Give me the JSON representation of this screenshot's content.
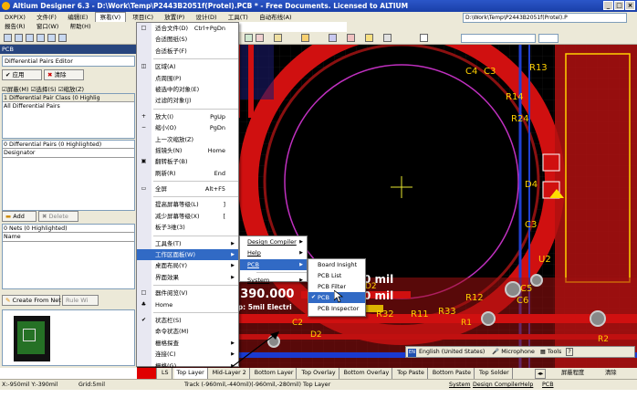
{
  "window": {
    "title": "Altium Designer 6.3 - D:\\Work\\Temp\\P2443B2051f(Protel).PCB * - Free Documents. Licensed to ALTIUM"
  },
  "menubar": {
    "row1": [
      "DXP(X)",
      "文件(F)",
      "编辑(E)",
      "察看(V)",
      "项目(C)",
      "放置(P)",
      "设计(D)",
      "工具(T)",
      "自动布线(A)"
    ],
    "row2": [
      "报告(R)",
      "窗口(W)",
      "帮助(H)"
    ],
    "path": "D:\\Work\\Temp\\P2443B2051f(Protel).P"
  },
  "panel": {
    "title": "PCB",
    "mode": "Differential Pairs Editor",
    "apply": "应用",
    "clear": "清除",
    "mask": "屏蔽(M)",
    "select": "选择(S)",
    "zoom": "缩放(Z)",
    "class_header": "1 Differential Pair Class (0 Highlig",
    "class_item": "All Differential Pairs",
    "pairs_header": "0 Differential Pairs (0 Highlighted)",
    "pairs_col": "Designator",
    "add": "Add",
    "delete": "Delete",
    "nets_header": "0 Nets (0 Highlighted)",
    "nets_col": "Name",
    "create": "Create From Net",
    "rule": "Rule Wi"
  },
  "view_menu": {
    "items": [
      {
        "icon": "□",
        "label": "适合文件(D)",
        "shortcut": "Ctrl+PgDn",
        "arrow": ""
      },
      {
        "icon": "",
        "label": "合适图纸(S)",
        "shortcut": "",
        "arrow": ""
      },
      {
        "icon": "",
        "label": "合适板子(F)",
        "shortcut": "",
        "arrow": ""
      },
      {
        "icon": "◫",
        "label": "区域(A)",
        "shortcut": "",
        "arrow": ""
      },
      {
        "icon": "",
        "label": "点周围(P)",
        "shortcut": "",
        "arrow": ""
      },
      {
        "icon": "",
        "label": "被选中的对象(E)",
        "shortcut": "",
        "arrow": ""
      },
      {
        "icon": "",
        "label": "过滤的对象(J)",
        "shortcut": "",
        "arrow": ""
      },
      {
        "icon": "+",
        "label": "放大(I)",
        "shortcut": "PgUp",
        "arrow": ""
      },
      {
        "icon": "−",
        "label": "缩小(O)",
        "shortcut": "PgDn",
        "arrow": ""
      },
      {
        "icon": "",
        "label": "上一次缩放(Z)",
        "shortcut": "",
        "arrow": ""
      },
      {
        "icon": "",
        "label": "摇镜头(N)",
        "shortcut": "Home",
        "arrow": ""
      },
      {
        "icon": "▣",
        "label": "翻转板子(B)",
        "shortcut": "",
        "arrow": ""
      },
      {
        "icon": "",
        "label": "刷新(R)",
        "shortcut": "End",
        "arrow": ""
      },
      {
        "icon": "▭",
        "label": "全屏",
        "shortcut": "Alt+F5",
        "arrow": ""
      },
      {
        "icon": "",
        "label": "提高屏幕等级(L)",
        "shortcut": "]",
        "arrow": ""
      },
      {
        "icon": "",
        "label": "减少屏幕等级(X)",
        "shortcut": "[",
        "arrow": ""
      },
      {
        "icon": "",
        "label": "板子3维(3)",
        "shortcut": "",
        "arrow": ""
      },
      {
        "icon": "",
        "label": "工具条(T)",
        "shortcut": "",
        "arrow": "▶"
      },
      {
        "icon": "",
        "label": "工作区面板(W)",
        "shortcut": "",
        "arrow": "▶"
      },
      {
        "icon": "",
        "label": "桌面布局(Y)",
        "shortcut": "",
        "arrow": "▶"
      },
      {
        "icon": "",
        "label": "界面效果",
        "shortcut": "",
        "arrow": "▶"
      },
      {
        "icon": "□",
        "label": "器件阅览(V)",
        "shortcut": "",
        "arrow": ""
      },
      {
        "icon": "♣",
        "label": "Home",
        "shortcut": "",
        "arrow": ""
      },
      {
        "icon": "✔",
        "label": "状态栏(S)",
        "shortcut": "",
        "arrow": ""
      },
      {
        "icon": "",
        "label": "命令状态(M)",
        "shortcut": "",
        "arrow": ""
      },
      {
        "icon": "",
        "label": "栅格探查",
        "shortcut": "",
        "arrow": "▶"
      },
      {
        "icon": "",
        "label": "连接(C)",
        "shortcut": "",
        "arrow": "▶"
      },
      {
        "icon": "",
        "label": "栅格(G)",
        "shortcut": "",
        "arrow": "▶"
      },
      {
        "icon": "",
        "label": "转换单位(U)",
        "shortcut": "Q",
        "arrow": ""
      }
    ]
  },
  "workspace_menu": {
    "items": [
      {
        "label": "Design Compiler",
        "arrow": "▶"
      },
      {
        "label": "Help",
        "arrow": "▶"
      },
      {
        "label": "PCB",
        "arrow": "▶"
      },
      {
        "label": "System",
        "arrow": "▶"
      }
    ]
  },
  "pcb_menu": {
    "items": [
      {
        "label": "Board Insight",
        "check": ""
      },
      {
        "label": "PCB List",
        "check": ""
      },
      {
        "label": "PCB Filter",
        "check": ""
      },
      {
        "label": "PCB",
        "check": "✔"
      },
      {
        "label": "PCB Inspector",
        "check": ""
      }
    ]
  },
  "canvas": {
    "labels": [
      "R13",
      "C4",
      "C3",
      "R14",
      "R24",
      "D4",
      "C3",
      "D2",
      "U2",
      "C5",
      "C6",
      "R12",
      "D2",
      "R33",
      "R32",
      "R11",
      "R1",
      "C2",
      "R2"
    ],
    "mil1": "0 mil",
    "mil2": "0 mil",
    "coord": "y: 390.000",
    "snap": "Snap: 5mil Electri",
    "lang": "English (United States)",
    "mic": "Microphone",
    "tools": "Tools"
  },
  "layers": {
    "tabs": [
      "LS",
      "Top Layer",
      "Mid-Layer 2",
      "Bottom Layer",
      "Top Overlay",
      "Bottom Overlay",
      "Top Paste",
      "Bottom Paste",
      "Top Solder"
    ],
    "mask": "屏蔽程度",
    "clear": "清除"
  },
  "status": {
    "coords": "X:-950mil Y:-390mil",
    "grid": "Grid:5mil",
    "track": "Track (-960mil,-440mil)(-960mil,-280mil) Top Layer",
    "tabs": [
      "System",
      "Design Compiler",
      "Help",
      "PCB"
    ]
  }
}
